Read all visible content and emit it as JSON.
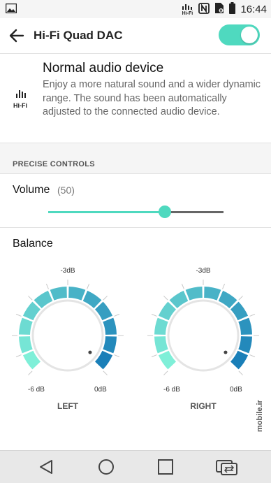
{
  "status_bar": {
    "time": "16:44",
    "hifi_badge": "Hi-Fi"
  },
  "app_bar": {
    "title": "Hi-Fi Quad DAC",
    "toggle_on": true
  },
  "mode_info": {
    "icon_label": "Hi-Fi",
    "title": "Normal audio device",
    "description": "Enjoy a more natural sound and a wider dynamic range. The sound has been automatically adjusted to the connected audio device."
  },
  "precise_controls": {
    "section_title": "PRECISE CONTROLS",
    "volume": {
      "label": "Volume",
      "value_text": "(50)",
      "value": 50,
      "max": 75
    },
    "balance": {
      "label": "Balance",
      "dials": [
        {
          "name": "LEFT",
          "top_label": "-3dB",
          "min_label": "-6 dB",
          "max_label": "0dB",
          "level": 0
        },
        {
          "name": "RIGHT",
          "top_label": "-3dB",
          "min_label": "-6 dB",
          "max_label": "0dB",
          "level": 0
        }
      ]
    }
  },
  "watermark": "mobile.ir",
  "colors": {
    "accent": "#4fd9bf",
    "dial_light": "#7fefd8",
    "dial_dark": "#1a7fb8"
  }
}
